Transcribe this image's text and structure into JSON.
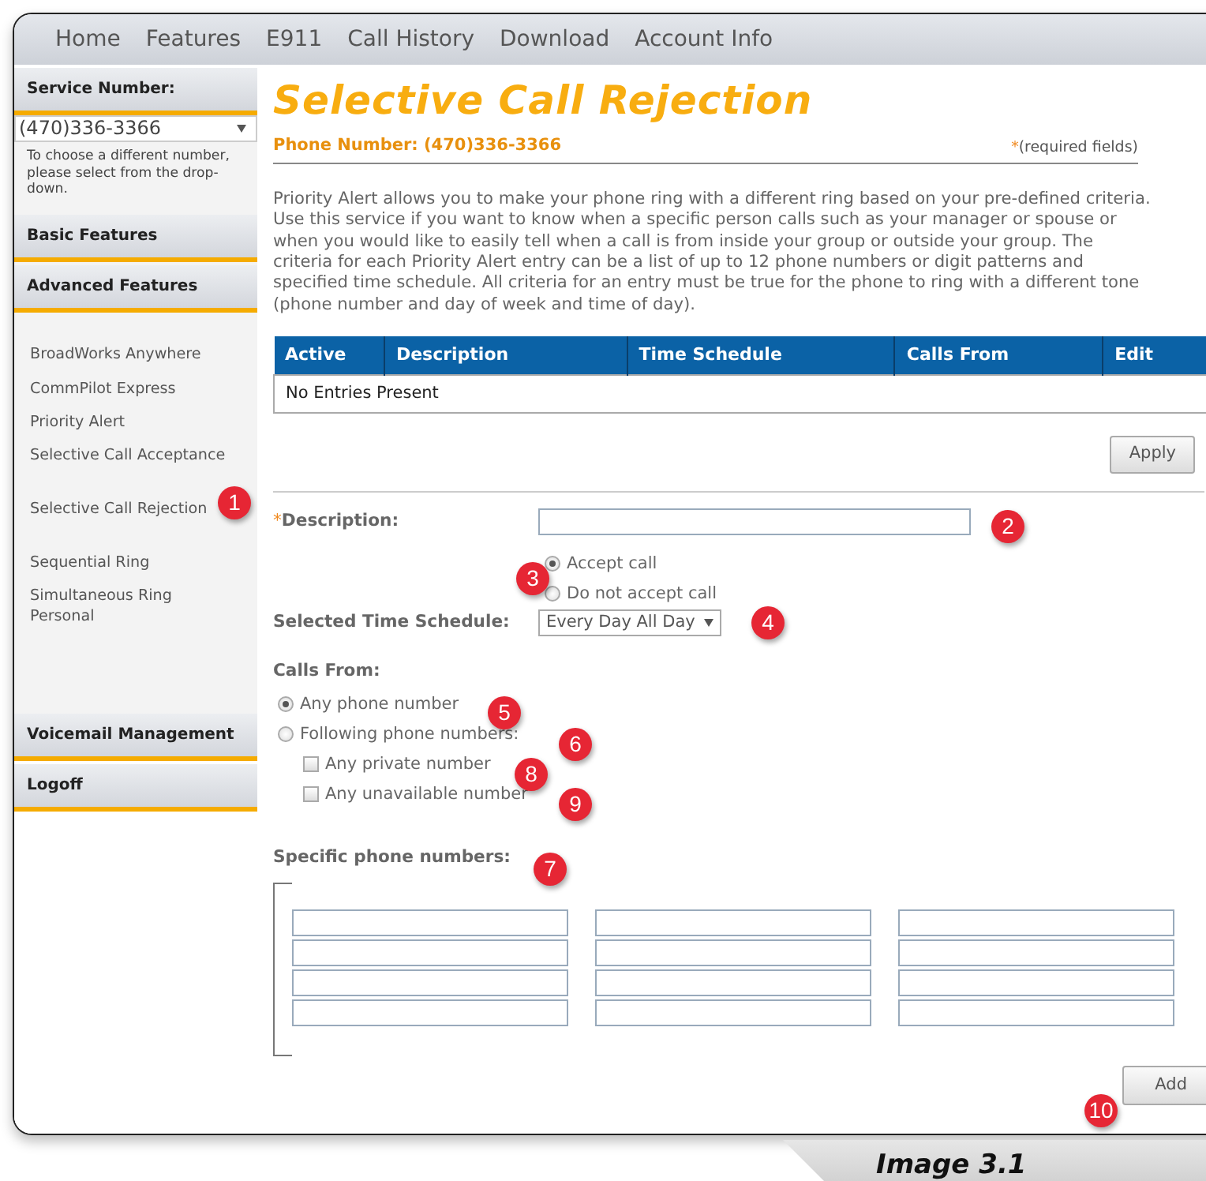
{
  "nav": [
    {
      "label": "Home"
    },
    {
      "label": "Features"
    },
    {
      "label": "E911"
    },
    {
      "label": "Call History"
    },
    {
      "label": "Download"
    },
    {
      "label": "Account Info"
    }
  ],
  "sidebar": {
    "service_label": "Service Number:",
    "service_number": "(470)336-3366",
    "help_text": "To choose a different number, please select from the drop-down.",
    "sections": [
      {
        "label": "Basic Features"
      },
      {
        "label": "Advanced Features"
      }
    ],
    "items": [
      {
        "label": "BroadWorks Anywhere"
      },
      {
        "label": "CommPilot Express"
      },
      {
        "label": "Priority Alert"
      },
      {
        "label": "Selective Call Acceptance"
      },
      {
        "label": "Selective Call Rejection"
      },
      {
        "label": "Sequential Ring"
      },
      {
        "label": "Simultaneous Ring Personal"
      }
    ],
    "bottom_sections": [
      {
        "label": "Voicemail Management"
      },
      {
        "label": "Logoff"
      }
    ]
  },
  "main": {
    "title": "Selective Call Rejection",
    "phone_number": "Phone Number: (470)336-3366",
    "required_note": {
      "mark": "*",
      "text": "(required fields)"
    },
    "intro": "Priority Alert allows you to make your phone ring with a different ring based on your pre-defined criteria. Use this service if you want to know when a specific person calls such as your manager or spouse or when you would like to easily tell when a call is from inside your group or outside your group. The criteria for each Priority Alert entry can be a list of up to 12 phone numbers or digit patterns and specified time schedule. All criteria for an entry must be true for the phone to ring with a different tone (phone number and day of week and time of day).",
    "table": {
      "columns": [
        "Active",
        "Description",
        "Time Schedule",
        "Calls From",
        "Edit"
      ],
      "empty_text": "No Entries Present"
    },
    "apply_button": "Apply",
    "description": {
      "mark": "*",
      "label": "Description:"
    },
    "accept_options": [
      {
        "label": "Accept call",
        "selected": true
      },
      {
        "label": "Do not accept call",
        "selected": false
      }
    ],
    "schedule": {
      "label": "Selected Time Schedule:",
      "value": "Every Day All Day"
    },
    "calls_from": {
      "label": "Calls From:",
      "options": [
        {
          "label": "Any phone number",
          "selected": true
        },
        {
          "label": "Following phone numbers:",
          "selected": false
        }
      ],
      "checkboxes": [
        {
          "label": "Any private number",
          "checked": false
        },
        {
          "label": "Any unavailable number",
          "checked": false
        }
      ]
    },
    "specific_label": "Specific phone numbers:",
    "add_button": "Add"
  },
  "callouts": [
    "1",
    "2",
    "3",
    "4",
    "5",
    "6",
    "7",
    "8",
    "9",
    "10"
  ],
  "caption": "Image 3.1"
}
